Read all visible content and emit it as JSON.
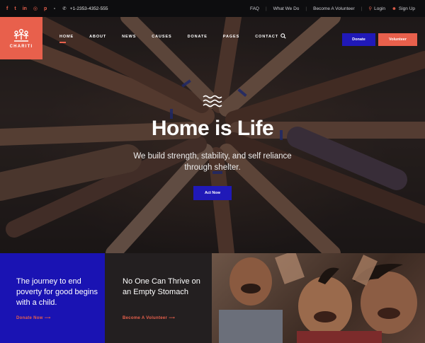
{
  "topbar": {
    "social": [
      {
        "icon": "facebook-icon",
        "glyph": "f"
      },
      {
        "icon": "twitter-icon",
        "glyph": "t"
      },
      {
        "icon": "linkedin-icon",
        "glyph": "in"
      },
      {
        "icon": "instagram-icon",
        "glyph": "◎"
      },
      {
        "icon": "pinterest-icon",
        "glyph": "p"
      }
    ],
    "phone": "+1-2353-4352-555",
    "links": [
      "FAQ",
      "What We Do",
      "Become A Volunteer"
    ],
    "login": "Login",
    "signup": "Sign Up"
  },
  "logo": {
    "text": "CHARITI"
  },
  "nav": {
    "items": [
      "HOME",
      "ABOUT",
      "NEWS",
      "CAUSES",
      "DONATE",
      "PAGES",
      "CONTACT"
    ],
    "active": "HOME"
  },
  "header_buttons": {
    "donate": "Donate",
    "volunteer": "Volunteer"
  },
  "hero": {
    "title": "Home is Life",
    "subtitle": "We build strength, stability, and self reliance through shelter.",
    "cta": "Act Now"
  },
  "cards": [
    {
      "text": "The journey to end poverty for good begins with a child.",
      "link": "Donate Now"
    },
    {
      "text": "No One Can Thrive on an Empty Stomach",
      "link": "Become A Volunteer"
    }
  ],
  "colors": {
    "accent": "#e8604c",
    "primary": "#2019b8",
    "dark": "#231f20"
  }
}
